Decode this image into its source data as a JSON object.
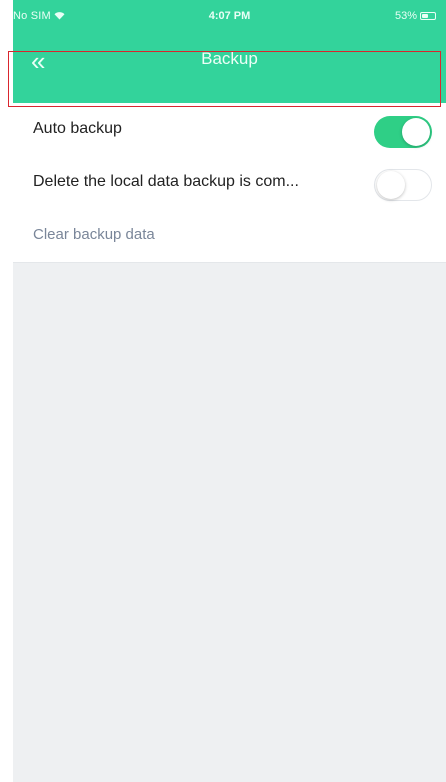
{
  "status_bar": {
    "carrier": "No SIM",
    "time": "4:07 PM",
    "battery": "53%",
    "battery_level": 0.53
  },
  "nav": {
    "title": "Backup",
    "back_glyph": "«"
  },
  "settings": [
    {
      "label": "Auto backup",
      "toggle": true,
      "on": true
    },
    {
      "label": "Delete the local data backup is com...",
      "toggle": true,
      "on": false
    },
    {
      "label": "Clear backup data",
      "toggle": false
    }
  ],
  "colors": {
    "header": "#33d39b",
    "toggle_on": "#2fcf86",
    "highlight": "#d9262e",
    "page_bg": "#eef0f2"
  },
  "icons": {
    "back": "double-chevron-left-icon",
    "wifi": "wifi-icon",
    "battery": "battery-icon"
  }
}
